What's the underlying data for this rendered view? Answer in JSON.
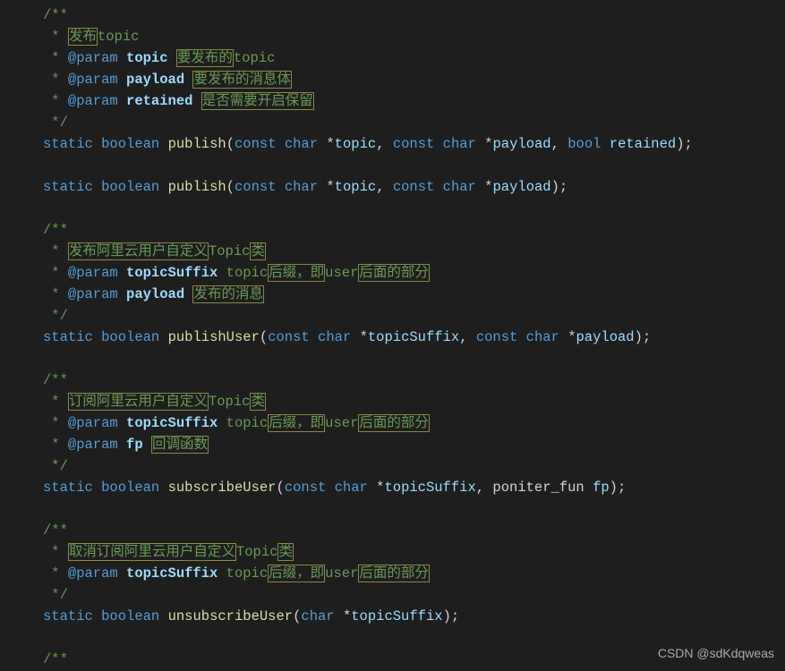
{
  "watermark": "CSDN @sdKdqweas",
  "comment1": {
    "open": "/**",
    "l1_star": " * ",
    "l1_desc": "发布",
    "l1_after": "topic",
    "l2_star": " * ",
    "l2_tag": "@param",
    "l2_name": " topic ",
    "l2_desc": "要发布的",
    "l2_after": "topic",
    "l3_star": " * ",
    "l3_tag": "@param",
    "l3_name": " payload ",
    "l3_desc": "要发布的消息体",
    "l4_star": " * ",
    "l4_tag": "@param",
    "l4_name": " retained ",
    "l4_desc": "是否需要开启保留",
    "close": " */"
  },
  "sig1": {
    "kw_static": "static",
    "kw_boolean": "boolean",
    "fn": "publish",
    "p1_const": "const",
    "p1_type": "char",
    "p1_star": "*",
    "p1_name": "topic",
    "c1": ",",
    "p2_const": "const",
    "p2_type": "char",
    "p2_star": "*",
    "p2_name": "payload",
    "c2": ",",
    "p3_type": "bool",
    "p3_name": "retained",
    "end": ");"
  },
  "sig2": {
    "kw_static": "static",
    "kw_boolean": "boolean",
    "fn": "publish",
    "p1_const": "const",
    "p1_type": "char",
    "p1_star": "*",
    "p1_name": "topic",
    "c1": ",",
    "p2_const": "const",
    "p2_type": "char",
    "p2_star": "*",
    "p2_name": "payload",
    "end": ");"
  },
  "comment2": {
    "open": "/**",
    "l1_star": " * ",
    "l1_desc": "发布阿里云用户自定义",
    "l1_mid": "Topic",
    "l1_desc2": "类",
    "l2_star": " * ",
    "l2_tag": "@param",
    "l2_name": " topicSuffix ",
    "l2_word": "topic",
    "l2_desc": "后缀，即",
    "l2_word2": "user",
    "l2_desc2": "后面的部分",
    "l3_star": " * ",
    "l3_tag": "@param",
    "l3_name": " payload ",
    "l3_desc": "发布的消息",
    "close": " */"
  },
  "sig3": {
    "kw_static": "static",
    "kw_boolean": "boolean",
    "fn": "publishUser",
    "p1_const": "const",
    "p1_type": "char",
    "p1_star": "*",
    "p1_name": "topicSuffix",
    "c1": ",",
    "p2_const": "const",
    "p2_type": "char",
    "p2_star": "*",
    "p2_name": "payload",
    "end": ");"
  },
  "comment3": {
    "open": "/**",
    "l1_star": " * ",
    "l1_desc": "订阅阿里云用户自定义",
    "l1_mid": "Topic",
    "l1_desc2": "类",
    "l2_star": " * ",
    "l2_tag": "@param",
    "l2_name": " topicSuffix ",
    "l2_word": "topic",
    "l2_desc": "后缀，即",
    "l2_word2": "user",
    "l2_desc2": "后面的部分",
    "l3_star": " * ",
    "l3_tag": "@param",
    "l3_name": " fp ",
    "l3_desc": "回调函数",
    "close": " */"
  },
  "sig4": {
    "kw_static": "static",
    "kw_boolean": "boolean",
    "fn": "subscribeUser",
    "p1_const": "const",
    "p1_type": "char",
    "p1_star": "*",
    "p1_name": "topicSuffix",
    "c1": ",",
    "p2_type": "poniter_fun",
    "p2_name": "fp",
    "end": ");"
  },
  "comment4": {
    "open": "/**",
    "l1_star": " * ",
    "l1_desc": "取消订阅阿里云用户自定义",
    "l1_mid": "Topic",
    "l1_desc2": "类",
    "l2_star": " * ",
    "l2_tag": "@param",
    "l2_name": " topicSuffix ",
    "l2_word": "topic",
    "l2_desc": "后缀，即",
    "l2_word2": "user",
    "l2_desc2": "后面的部分",
    "close": " */"
  },
  "sig5": {
    "kw_static": "static",
    "kw_boolean": "boolean",
    "fn": "unsubscribeUser",
    "p1_type": "char",
    "p1_star": "*",
    "p1_name": "topicSuffix",
    "end": ");"
  },
  "comment5": {
    "open": "/**"
  }
}
